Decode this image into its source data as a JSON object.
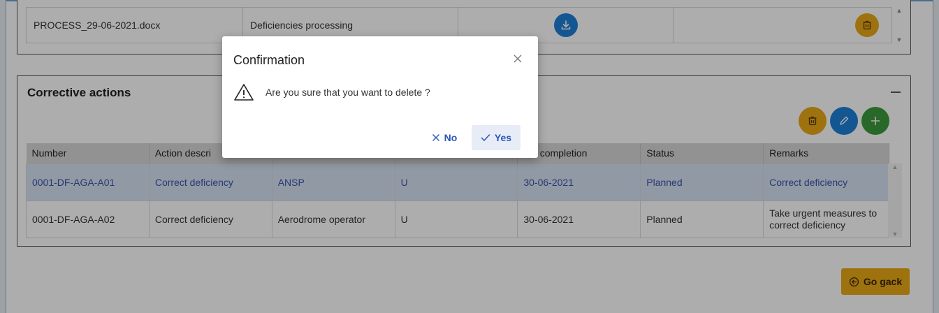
{
  "documents": {
    "row": {
      "file": "PROCESS_29-06-2021.docx",
      "description": "Deficiencies processing"
    }
  },
  "corrective_actions": {
    "title": "Corrective actions",
    "columns": [
      "Number",
      "Action descri",
      "",
      "",
      "ate completion",
      "Status",
      "Remarks"
    ],
    "rows": [
      [
        "0001-DF-AGA-A01",
        "Correct deficiency",
        "ANSP",
        "U",
        "30-06-2021",
        "Planned",
        "Correct deficiency"
      ],
      [
        "0001-DF-AGA-A02",
        "Correct deficiency",
        "Aerodrome operator",
        "U",
        "30-06-2021",
        "Planned",
        "Take urgent measures to correct deficiency"
      ]
    ]
  },
  "go_back_label": "Go gack",
  "dialog": {
    "title": "Confirmation",
    "message": "Are you sure that you want to delete ?",
    "no_label": "No",
    "yes_label": "Yes"
  },
  "colors": {
    "blue": "#1e7fd8",
    "yellow": "#e8a817",
    "green": "#3c9a3c",
    "link": "#3a55a8"
  },
  "icons": [
    "download-icon",
    "trash-icon",
    "pencil-icon",
    "plus-icon",
    "close-icon",
    "warning-icon",
    "check-icon",
    "arrow-left-circle-icon"
  ]
}
